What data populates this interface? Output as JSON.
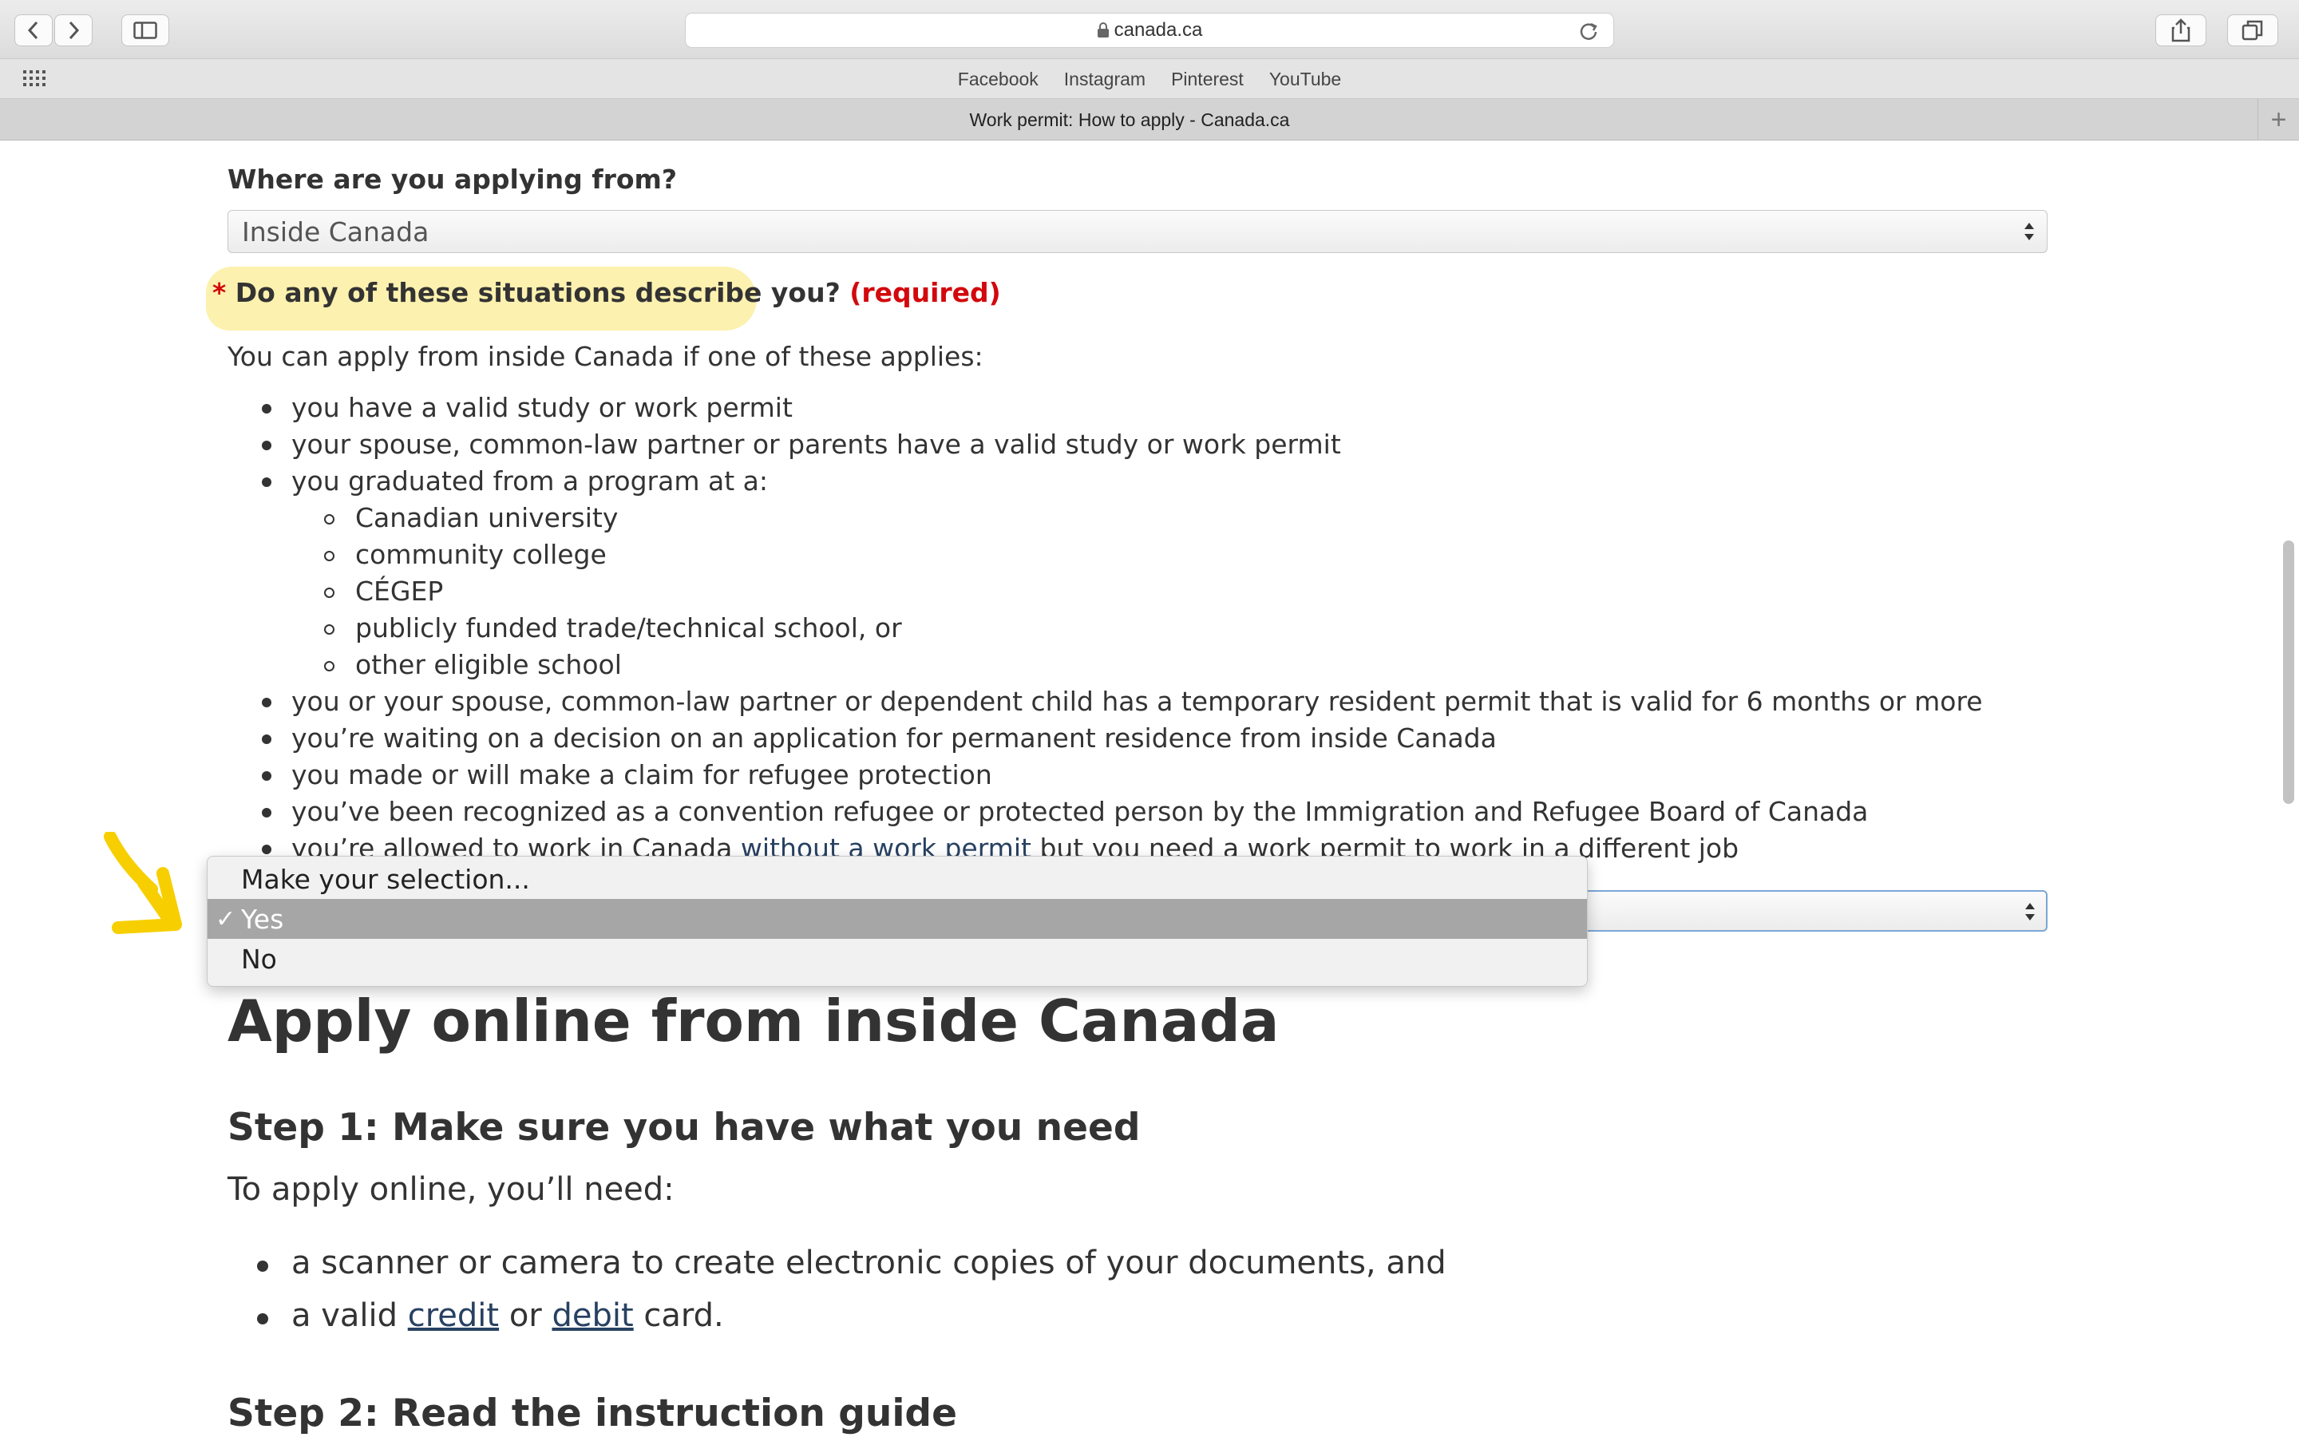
{
  "browser": {
    "url": "canada.ca",
    "tab_title": "Work permit: How to apply - Canada.ca",
    "favorites": [
      "Facebook",
      "Instagram",
      "Pinterest",
      "YouTube"
    ],
    "new_tab": "+"
  },
  "form": {
    "q1_label": "Where are you applying from?",
    "q1_value": "Inside Canada",
    "q2_star": "*",
    "q2_label": "Do any of these situations describe you?",
    "q2_required": "(required)",
    "intro": "You can apply from inside Canada if one of these applies:",
    "bullets": [
      "you have a valid study or work permit",
      "your spouse, common-law partner or parents have a valid study or work permit",
      "you graduated from a program at a:",
      "you or your spouse, common-law partner or dependent child has a temporary resident permit that is valid for 6 months or more",
      "you’re waiting on a decision on an application for permanent residence from inside Canada",
      "you made or will make a claim for refugee protection",
      "you’ve been recognized as a convention refugee or protected person by the Immigration and Refugee Board of Canada"
    ],
    "sub_bullets": [
      "Canadian university",
      "community college",
      "CÉGEP",
      "publicly funded trade/technical school, or",
      "other eligible school"
    ],
    "last_bullet_pre": "you’re allowed to work in Canada ",
    "last_bullet_link": "without a work permit",
    "last_bullet_post": " but you need a work permit to work in a different job"
  },
  "dropdown": {
    "options": [
      "Make your selection...",
      "Yes",
      "No"
    ],
    "selected": "Yes",
    "check": "✓"
  },
  "content": {
    "h1": "Apply online from inside Canada",
    "step1": "Step 1: Make sure you have what you need",
    "step1_intro": "To apply online, you’ll need:",
    "need1": "a scanner or camera to create electronic copies of your documents, and",
    "need2_pre": "a valid ",
    "need2_credit": "credit",
    "need2_or": " or ",
    "need2_debit": "debit",
    "need2_post": " card.",
    "step2": "Step 2: Read the instruction guide"
  },
  "colors": {
    "required_red": "#d3080c",
    "link_blue": "#284162",
    "highlight_yellow": "#fbeea0",
    "arrow_yellow": "#f7cf00"
  }
}
